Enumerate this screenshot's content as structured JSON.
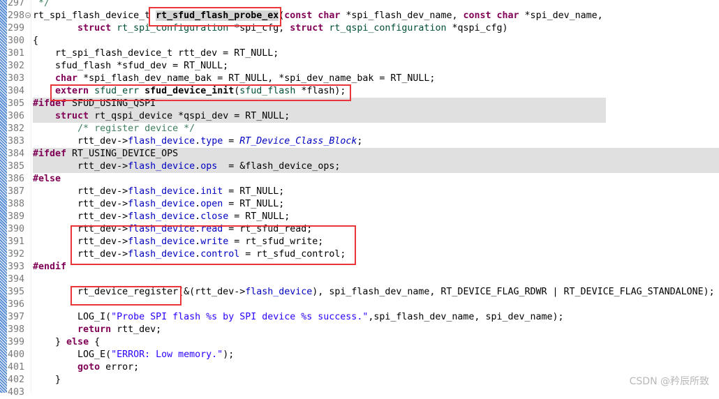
{
  "editor": {
    "lines": [
      {
        "num": "297",
        "tokens": [
          [
            " */",
            "c"
          ]
        ]
      },
      {
        "num": "298",
        "fold": true,
        "tokens": [
          [
            "rt_spi_flash_device_t ",
            ""
          ],
          [
            "rt_sfud_flash_probe_ex",
            "hl"
          ],
          [
            "(",
            ""
          ],
          [
            "const",
            "k"
          ],
          [
            " ",
            ""
          ],
          [
            "char",
            "k"
          ],
          [
            " *spi_flash_dev_name, ",
            ""
          ],
          [
            "const",
            "k"
          ],
          [
            " ",
            ""
          ],
          [
            "char",
            "k"
          ],
          [
            " *spi_dev_name,",
            ""
          ]
        ]
      },
      {
        "num": "299",
        "tokens": [
          [
            "        ",
            ""
          ],
          [
            "struct",
            "k"
          ],
          [
            " ",
            ""
          ],
          [
            "rt_spi_configuration",
            "t"
          ],
          [
            " *spi_cfg, ",
            ""
          ],
          [
            "struct",
            "k"
          ],
          [
            " ",
            ""
          ],
          [
            "rt_qspi_configuration",
            "t"
          ],
          [
            " *qspi_cfg)",
            ""
          ]
        ]
      },
      {
        "num": "300",
        "tokens": [
          [
            "{",
            ""
          ]
        ]
      },
      {
        "num": "301",
        "tokens": [
          [
            "    rt_spi_flash_device_t rtt_dev = RT_NULL;",
            ""
          ]
        ]
      },
      {
        "num": "302",
        "tokens": [
          [
            "    sfud_flash *sfud_dev = RT_NULL;",
            ""
          ]
        ]
      },
      {
        "num": "303",
        "tokens": [
          [
            "    ",
            ""
          ],
          [
            "char",
            "k"
          ],
          [
            " *spi_flash_dev_name_bak = RT_NULL, *spi_dev_name_bak = RT_NULL;",
            ""
          ]
        ]
      },
      {
        "num": "304",
        "tokens": [
          [
            "    ",
            ""
          ],
          [
            "extern",
            "k"
          ],
          [
            " ",
            ""
          ],
          [
            "sfud_err",
            "t"
          ],
          [
            " ",
            ""
          ],
          [
            "sfud_device_init",
            "b"
          ],
          [
            "(",
            ""
          ],
          [
            "sfud_flash",
            "t"
          ],
          [
            " *flash);",
            ""
          ]
        ]
      },
      {
        "num": "305",
        "bg": "gray-short",
        "tokens": [
          [
            "#ifdef",
            "k"
          ],
          [
            " SFUD_USING_QSPI",
            ""
          ]
        ]
      },
      {
        "num": "306",
        "bg": "gray-short",
        "tokens": [
          [
            "    ",
            ""
          ],
          [
            "struct",
            "k"
          ],
          [
            " rt_qspi_device *qspi_dev = RT_NULL;",
            ""
          ]
        ]
      },
      {
        "num": "382",
        "tokens": [
          [
            "        ",
            ""
          ],
          [
            "/* register device */",
            "c"
          ]
        ]
      },
      {
        "num": "383",
        "tokens": [
          [
            "        rtt_dev->",
            ""
          ],
          [
            "flash_device",
            "f"
          ],
          [
            ".",
            ""
          ],
          [
            "type",
            "f"
          ],
          [
            " = ",
            ""
          ],
          [
            "RT_Device_Class_Block",
            "m"
          ],
          [
            ";",
            ""
          ]
        ]
      },
      {
        "num": "384",
        "bg": "gray",
        "tokens": [
          [
            "#ifdef",
            "k"
          ],
          [
            " RT_USING_DEVICE_OPS",
            ""
          ]
        ]
      },
      {
        "num": "385",
        "bg": "gray",
        "tokens": [
          [
            "        rtt_dev->",
            ""
          ],
          [
            "flash_device",
            "f"
          ],
          [
            ".",
            ""
          ],
          [
            "ops",
            "f"
          ],
          [
            "  = &flash_device_ops;",
            ""
          ]
        ]
      },
      {
        "num": "386",
        "tokens": [
          [
            "#else",
            "k"
          ]
        ]
      },
      {
        "num": "387",
        "tokens": [
          [
            "        rtt_dev->",
            ""
          ],
          [
            "flash_device",
            "f"
          ],
          [
            ".",
            ""
          ],
          [
            "init",
            "f"
          ],
          [
            " = RT_NULL;",
            ""
          ]
        ]
      },
      {
        "num": "388",
        "tokens": [
          [
            "        rtt_dev->",
            ""
          ],
          [
            "flash_device",
            "f"
          ],
          [
            ".",
            ""
          ],
          [
            "open",
            "f"
          ],
          [
            " = RT_NULL;",
            ""
          ]
        ]
      },
      {
        "num": "389",
        "tokens": [
          [
            "        rtt_dev->",
            ""
          ],
          [
            "flash_device",
            "f"
          ],
          [
            ".",
            ""
          ],
          [
            "close",
            "f"
          ],
          [
            " = RT_NULL;",
            ""
          ]
        ]
      },
      {
        "num": "390",
        "tokens": [
          [
            "        rtt_dev->",
            ""
          ],
          [
            "flash_device",
            "f"
          ],
          [
            ".",
            ""
          ],
          [
            "read",
            "f"
          ],
          [
            " = rt_sfud_read;",
            ""
          ]
        ]
      },
      {
        "num": "391",
        "tokens": [
          [
            "        rtt_dev->",
            ""
          ],
          [
            "flash_device",
            "f"
          ],
          [
            ".",
            ""
          ],
          [
            "write",
            "f"
          ],
          [
            " = rt_sfud_write;",
            ""
          ]
        ]
      },
      {
        "num": "392",
        "tokens": [
          [
            "        rtt_dev->",
            ""
          ],
          [
            "flash_device",
            "f"
          ],
          [
            ".",
            ""
          ],
          [
            "control",
            "f"
          ],
          [
            " = rt_sfud_control;",
            ""
          ]
        ]
      },
      {
        "num": "393",
        "tokens": [
          [
            "#endif",
            "k"
          ]
        ]
      },
      {
        "num": "394",
        "tokens": []
      },
      {
        "num": "395",
        "tokens": [
          [
            "        rt_device_register(&(rtt_dev->",
            ""
          ],
          [
            "flash_device",
            "f"
          ],
          [
            "), spi_flash_dev_name, RT_DEVICE_FLAG_RDWR | RT_DEVICE_FLAG_STANDALONE);",
            ""
          ]
        ]
      },
      {
        "num": "396",
        "tokens": []
      },
      {
        "num": "397",
        "tokens": [
          [
            "        LOG_I(",
            ""
          ],
          [
            "\"Probe SPI flash %s by SPI device %s success.\"",
            "s"
          ],
          [
            ",spi_flash_dev_name, spi_dev_name);",
            ""
          ]
        ]
      },
      {
        "num": "398",
        "tokens": [
          [
            "        ",
            ""
          ],
          [
            "return",
            "k"
          ],
          [
            " rtt_dev;",
            ""
          ]
        ]
      },
      {
        "num": "399",
        "tokens": [
          [
            "    } ",
            ""
          ],
          [
            "else",
            "k"
          ],
          [
            " {",
            ""
          ]
        ]
      },
      {
        "num": "400",
        "tokens": [
          [
            "        LOG_E(",
            ""
          ],
          [
            "\"ERROR: Low memory.\"",
            "s"
          ],
          [
            ");",
            ""
          ]
        ]
      },
      {
        "num": "401",
        "tokens": [
          [
            "        ",
            ""
          ],
          [
            "goto",
            "k"
          ],
          [
            " error;",
            ""
          ]
        ]
      },
      {
        "num": "402",
        "tokens": [
          [
            "    }",
            ""
          ]
        ]
      },
      {
        "num": "403",
        "tokens": []
      }
    ],
    "highlight_color": "#e8363a"
  },
  "watermark": "CSDN @矜辰所致"
}
